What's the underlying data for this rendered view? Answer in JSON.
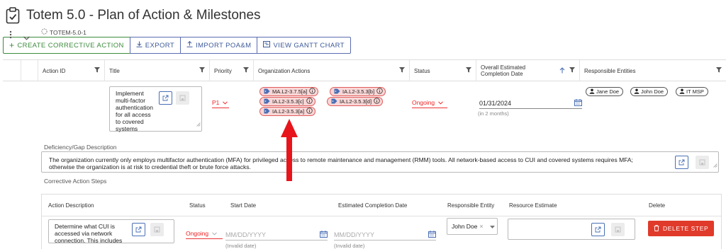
{
  "page": {
    "title": "Totem 5.0 - Plan of Action & Milestones",
    "icon": "clipboard-check-icon"
  },
  "toolbar": {
    "create_label": "CREATE CORRECTIVE ACTION",
    "export_label": "EXPORT",
    "import_label": "IMPORT POA&M",
    "gantt_label": "VIEW GANTT CHART"
  },
  "columns": {
    "action_id": "Action ID",
    "title": "Title",
    "priority": "Priority",
    "org_actions": "Organization Actions",
    "status": "Status",
    "completion_date": "Overall Estimated Completion Date",
    "responsible": "Responsible Entities"
  },
  "row": {
    "action_id": "TOTEM-5.0-1",
    "title_lines": [
      "Implement",
      "multi-factor",
      "authentication",
      "for all access",
      "to covered",
      "systems"
    ],
    "priority": "P1",
    "org_actions": [
      "MA.L2-3.7.5[a]",
      "IA.L2-3.5.3[b]",
      "IA.L2-3.5.3[c]",
      "IA.L2-3.5.3[d]",
      "IA.L2-3.5.3[a]"
    ],
    "status": "Ongoing",
    "completion_date": "01/31/2024",
    "completion_hint": "(in 2 months)",
    "responsible": [
      "Jane Doe",
      "John Doe",
      "IT MSP"
    ]
  },
  "deficiency": {
    "label": "Deficiency/Gap Description",
    "line1": "The organization currently only employs multifactor authentication (MFA) for privileged access to remote maintenance and management (RMM) tools.  All network-based access to CUI and covered systems requires MFA;",
    "line2": "otherwise the organization is at risk to credential theft or brute force attacks."
  },
  "steps": {
    "label": "Corrective Action Steps",
    "columns": {
      "description": "Action Description",
      "status": "Status",
      "start": "Start Date",
      "est_completion": "Estimated Completion Date",
      "entity": "Responsible Entity",
      "resource": "Resource Estimate",
      "delete": "Delete"
    },
    "row": {
      "description_lines": [
        "Determine what CUI is",
        "accessed via network",
        "connection.  This includes"
      ],
      "status": "Ongoing",
      "start_placeholder": "MM/DD/YYYY",
      "start_hint": "(Invalid date)",
      "end_placeholder": "MM/DD/YYYY",
      "end_hint": "(Invalid date)",
      "entity": "John Doe",
      "delete_label": "DELETE STEP"
    }
  },
  "colors": {
    "accent_blue": "#3d5a99",
    "create_green": "#3d8b3d",
    "chip_fill": "#f9d6d6",
    "chip_border": "#e05b5b",
    "status_red": "#e22222",
    "delete_red": "#e03a2a",
    "arrow_red": "#e8141b"
  }
}
